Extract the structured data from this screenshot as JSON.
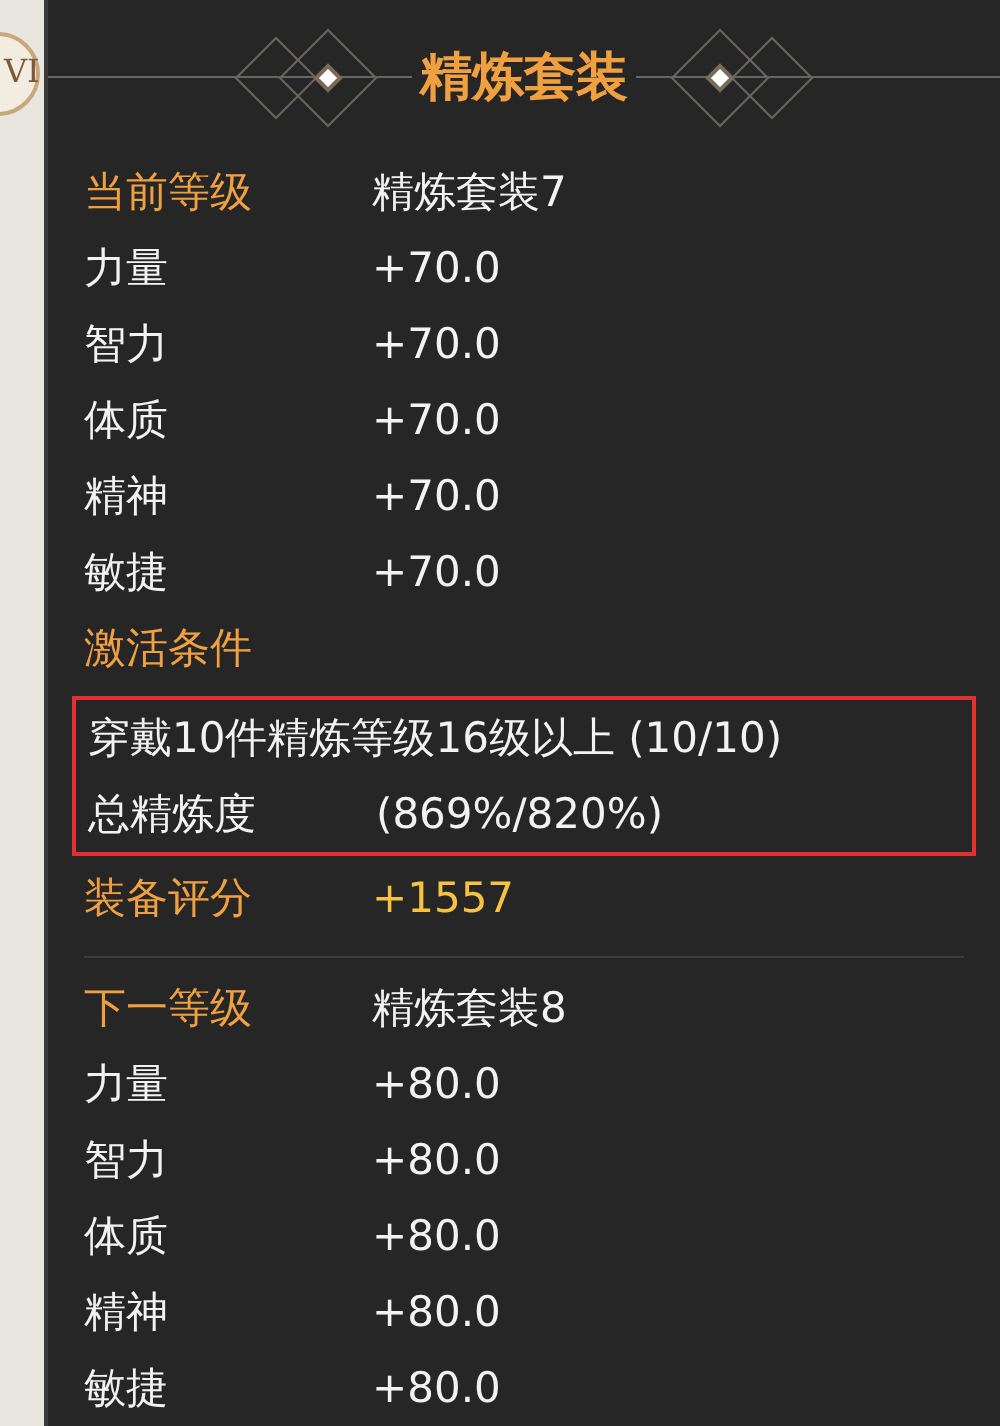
{
  "side_badge": {
    "text": "VI"
  },
  "title": "精炼套装",
  "current": {
    "label": "当前等级",
    "value": "精炼套装7",
    "stats": [
      {
        "name": "力量",
        "value": "+70.0"
      },
      {
        "name": "智力",
        "value": "+70.0"
      },
      {
        "name": "体质",
        "value": "+70.0"
      },
      {
        "name": "精神",
        "value": "+70.0"
      },
      {
        "name": "敏捷",
        "value": "+70.0"
      }
    ]
  },
  "conditions": {
    "label": "激活条件",
    "highlighted": true,
    "items": [
      {
        "kind": "line",
        "text": "穿戴10件精炼等级16级以上 (10/10)"
      },
      {
        "kind": "pair",
        "name": "总精炼度",
        "value": "(869%/820%)"
      }
    ]
  },
  "score": {
    "label": "装备评分",
    "value": "+1557"
  },
  "next": {
    "label": "下一等级",
    "value": "精炼套装8",
    "stats": [
      {
        "name": "力量",
        "value": "+80.0"
      },
      {
        "name": "智力",
        "value": "+80.0"
      },
      {
        "name": "体质",
        "value": "+80.0"
      },
      {
        "name": "精神",
        "value": "+80.0"
      },
      {
        "name": "敏捷",
        "value": "+80.0"
      }
    ]
  }
}
